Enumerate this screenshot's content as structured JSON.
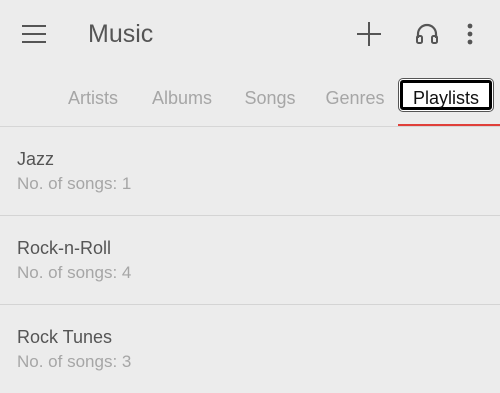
{
  "app": {
    "title": "Music"
  },
  "toolbar": {
    "menu_icon": "hamburger-menu-icon",
    "add_icon": "plus-icon",
    "headset_icon": "headphones-icon",
    "more_icon": "more-vertical-icon"
  },
  "tabs": [
    {
      "label": "Artists",
      "selected": false
    },
    {
      "label": "Albums",
      "selected": false
    },
    {
      "label": "Songs",
      "selected": false
    },
    {
      "label": "Genres",
      "selected": false
    },
    {
      "label": "Playlists",
      "selected": true
    }
  ],
  "colors": {
    "background": "#ececec",
    "accent": "#e0403a",
    "text_primary": "#555555",
    "text_secondary": "#a6a6a6"
  },
  "playlists": [
    {
      "name": "Jazz",
      "count_text": "No. of songs: 1"
    },
    {
      "name": "Rock-n-Roll",
      "count_text": "No. of songs: 4"
    },
    {
      "name": "Rock Tunes",
      "count_text": "No. of songs: 3"
    }
  ]
}
